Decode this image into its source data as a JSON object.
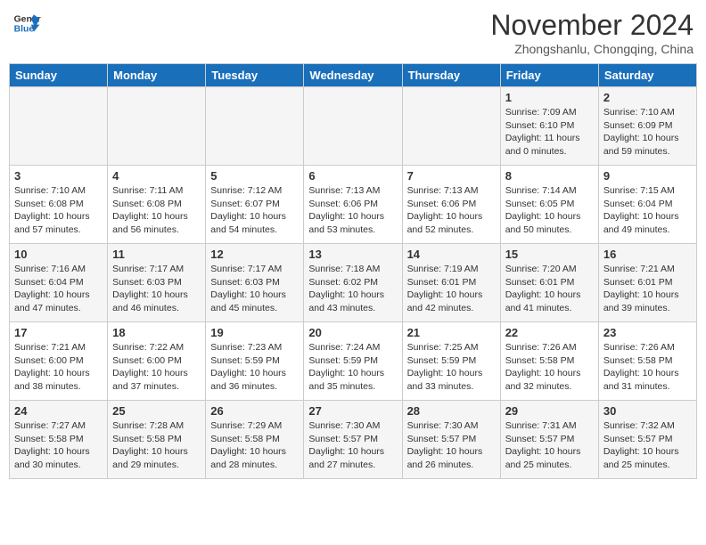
{
  "header": {
    "logo_line1": "General",
    "logo_line2": "Blue",
    "month_title": "November 2024",
    "location": "Zhongshanlu, Chongqing, China"
  },
  "weekdays": [
    "Sunday",
    "Monday",
    "Tuesday",
    "Wednesday",
    "Thursday",
    "Friday",
    "Saturday"
  ],
  "weeks": [
    [
      {
        "day": "",
        "info": ""
      },
      {
        "day": "",
        "info": ""
      },
      {
        "day": "",
        "info": ""
      },
      {
        "day": "",
        "info": ""
      },
      {
        "day": "",
        "info": ""
      },
      {
        "day": "1",
        "info": "Sunrise: 7:09 AM\nSunset: 6:10 PM\nDaylight: 11 hours\nand 0 minutes."
      },
      {
        "day": "2",
        "info": "Sunrise: 7:10 AM\nSunset: 6:09 PM\nDaylight: 10 hours\nand 59 minutes."
      }
    ],
    [
      {
        "day": "3",
        "info": "Sunrise: 7:10 AM\nSunset: 6:08 PM\nDaylight: 10 hours\nand 57 minutes."
      },
      {
        "day": "4",
        "info": "Sunrise: 7:11 AM\nSunset: 6:08 PM\nDaylight: 10 hours\nand 56 minutes."
      },
      {
        "day": "5",
        "info": "Sunrise: 7:12 AM\nSunset: 6:07 PM\nDaylight: 10 hours\nand 54 minutes."
      },
      {
        "day": "6",
        "info": "Sunrise: 7:13 AM\nSunset: 6:06 PM\nDaylight: 10 hours\nand 53 minutes."
      },
      {
        "day": "7",
        "info": "Sunrise: 7:13 AM\nSunset: 6:06 PM\nDaylight: 10 hours\nand 52 minutes."
      },
      {
        "day": "8",
        "info": "Sunrise: 7:14 AM\nSunset: 6:05 PM\nDaylight: 10 hours\nand 50 minutes."
      },
      {
        "day": "9",
        "info": "Sunrise: 7:15 AM\nSunset: 6:04 PM\nDaylight: 10 hours\nand 49 minutes."
      }
    ],
    [
      {
        "day": "10",
        "info": "Sunrise: 7:16 AM\nSunset: 6:04 PM\nDaylight: 10 hours\nand 47 minutes."
      },
      {
        "day": "11",
        "info": "Sunrise: 7:17 AM\nSunset: 6:03 PM\nDaylight: 10 hours\nand 46 minutes."
      },
      {
        "day": "12",
        "info": "Sunrise: 7:17 AM\nSunset: 6:03 PM\nDaylight: 10 hours\nand 45 minutes."
      },
      {
        "day": "13",
        "info": "Sunrise: 7:18 AM\nSunset: 6:02 PM\nDaylight: 10 hours\nand 43 minutes."
      },
      {
        "day": "14",
        "info": "Sunrise: 7:19 AM\nSunset: 6:01 PM\nDaylight: 10 hours\nand 42 minutes."
      },
      {
        "day": "15",
        "info": "Sunrise: 7:20 AM\nSunset: 6:01 PM\nDaylight: 10 hours\nand 41 minutes."
      },
      {
        "day": "16",
        "info": "Sunrise: 7:21 AM\nSunset: 6:01 PM\nDaylight: 10 hours\nand 39 minutes."
      }
    ],
    [
      {
        "day": "17",
        "info": "Sunrise: 7:21 AM\nSunset: 6:00 PM\nDaylight: 10 hours\nand 38 minutes."
      },
      {
        "day": "18",
        "info": "Sunrise: 7:22 AM\nSunset: 6:00 PM\nDaylight: 10 hours\nand 37 minutes."
      },
      {
        "day": "19",
        "info": "Sunrise: 7:23 AM\nSunset: 5:59 PM\nDaylight: 10 hours\nand 36 minutes."
      },
      {
        "day": "20",
        "info": "Sunrise: 7:24 AM\nSunset: 5:59 PM\nDaylight: 10 hours\nand 35 minutes."
      },
      {
        "day": "21",
        "info": "Sunrise: 7:25 AM\nSunset: 5:59 PM\nDaylight: 10 hours\nand 33 minutes."
      },
      {
        "day": "22",
        "info": "Sunrise: 7:26 AM\nSunset: 5:58 PM\nDaylight: 10 hours\nand 32 minutes."
      },
      {
        "day": "23",
        "info": "Sunrise: 7:26 AM\nSunset: 5:58 PM\nDaylight: 10 hours\nand 31 minutes."
      }
    ],
    [
      {
        "day": "24",
        "info": "Sunrise: 7:27 AM\nSunset: 5:58 PM\nDaylight: 10 hours\nand 30 minutes."
      },
      {
        "day": "25",
        "info": "Sunrise: 7:28 AM\nSunset: 5:58 PM\nDaylight: 10 hours\nand 29 minutes."
      },
      {
        "day": "26",
        "info": "Sunrise: 7:29 AM\nSunset: 5:58 PM\nDaylight: 10 hours\nand 28 minutes."
      },
      {
        "day": "27",
        "info": "Sunrise: 7:30 AM\nSunset: 5:57 PM\nDaylight: 10 hours\nand 27 minutes."
      },
      {
        "day": "28",
        "info": "Sunrise: 7:30 AM\nSunset: 5:57 PM\nDaylight: 10 hours\nand 26 minutes."
      },
      {
        "day": "29",
        "info": "Sunrise: 7:31 AM\nSunset: 5:57 PM\nDaylight: 10 hours\nand 25 minutes."
      },
      {
        "day": "30",
        "info": "Sunrise: 7:32 AM\nSunset: 5:57 PM\nDaylight: 10 hours\nand 25 minutes."
      }
    ]
  ]
}
